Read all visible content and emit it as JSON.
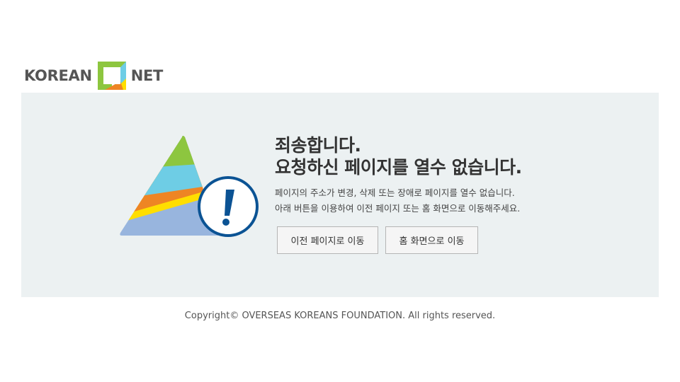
{
  "header": {
    "logo_left": "KOREAN",
    "logo_right": "NET"
  },
  "error": {
    "title_line1": "죄송합니다.",
    "title_line2": "요청하신 페이지를 열수 없습니다.",
    "desc_line1": "페이지의 주소가 변경, 삭제 또는 장애로 페이지를 열수 없습니다.",
    "desc_line2": "아래 버튼을 이용하여 이전 페이지 또는 홈 화면으로 이동해주세요.",
    "icon": "exclamation-triangle-illustration"
  },
  "buttons": {
    "back_label": "이전 페이지로 이동",
    "home_label": "홈 화면으로 이동"
  },
  "footer": {
    "copyright": "Copyright© OVERSEAS KOREANS FOUNDATION. All rights reserved."
  },
  "colors": {
    "panel_bg": "#ecf1f2",
    "green": "#8dc63f",
    "sky": "#6ecde5",
    "orange": "#ee8524",
    "yellow": "#ffde00",
    "blue": "#98b5de",
    "badge_border": "#0b5394"
  }
}
